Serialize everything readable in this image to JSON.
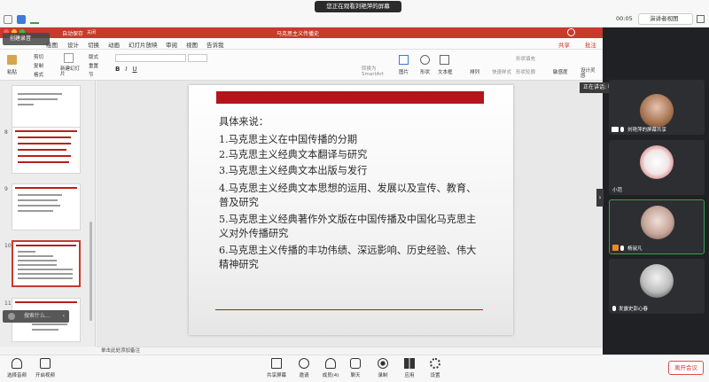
{
  "meeting": {
    "share_banner": "您正在观看刘艳萍的屏幕",
    "timer": "00:05",
    "view_button": "演讲者视图"
  },
  "ppt": {
    "autosave": "自动保存",
    "autosave_state": "关闭",
    "doc_title": "马克思主义传播史",
    "menu": [
      "绘图",
      "设计",
      "切换",
      "动画",
      "幻灯片放映",
      "审阅",
      "视图",
      "告诉我"
    ],
    "share": "共享",
    "comment": "批注",
    "ribbon": {
      "paste": "粘贴",
      "cut": "剪切",
      "copy": "复制",
      "format": "格式",
      "new_slide": "新建幻灯片",
      "layout": "版式",
      "reset": "重置",
      "section": "节",
      "to_smartart": "转换为SmartArt",
      "picture": "图片",
      "shape": "形状",
      "textbox": "文本框",
      "arrange": "排列",
      "quick_style": "快速样式",
      "shape_fill": "形状填充",
      "shape_outline": "形状轮廓",
      "sensitivity": "敏感度",
      "designer": "设计灵感"
    },
    "thumb_numbers": [
      "8",
      "9",
      "10",
      "11"
    ],
    "chip_top": "创建录音",
    "chip_bottom": "搜索什么...",
    "notes_placeholder": "单击此处添加备注",
    "slide_lines": [
      "具体来说：",
      "1.马克思主义在中国传播的分期",
      "2.马克思主义经典文本翻译与研究",
      "3.马克思主义经典文本出版与发行",
      "4.马克思主义经典文本思想的运用、发展以及宣传、教育、",
      "普及研究",
      "5.马克思主义经典著作外文版在中国传播及中国化马克思主",
      "义对外传播研究",
      "6.马克思主义传播的丰功伟绩、深远影响、历史经验、伟大",
      "精神研究"
    ]
  },
  "participants": {
    "speaking_banner": "正在讲话: 杨淑凡; 刘艳萍;",
    "tiles": [
      {
        "name": "刘艳萍的屏幕共享"
      },
      {
        "name": "小范"
      },
      {
        "name": "杨淑凡"
      },
      {
        "name": "发露史彭心春"
      }
    ]
  },
  "toolbar": {
    "left": [
      "选择音频",
      "开启视频"
    ],
    "center": [
      "共享屏幕",
      "邀请",
      "成员(4)",
      "聊天",
      "录制",
      "应用",
      "设置"
    ],
    "end": "离开会议"
  }
}
